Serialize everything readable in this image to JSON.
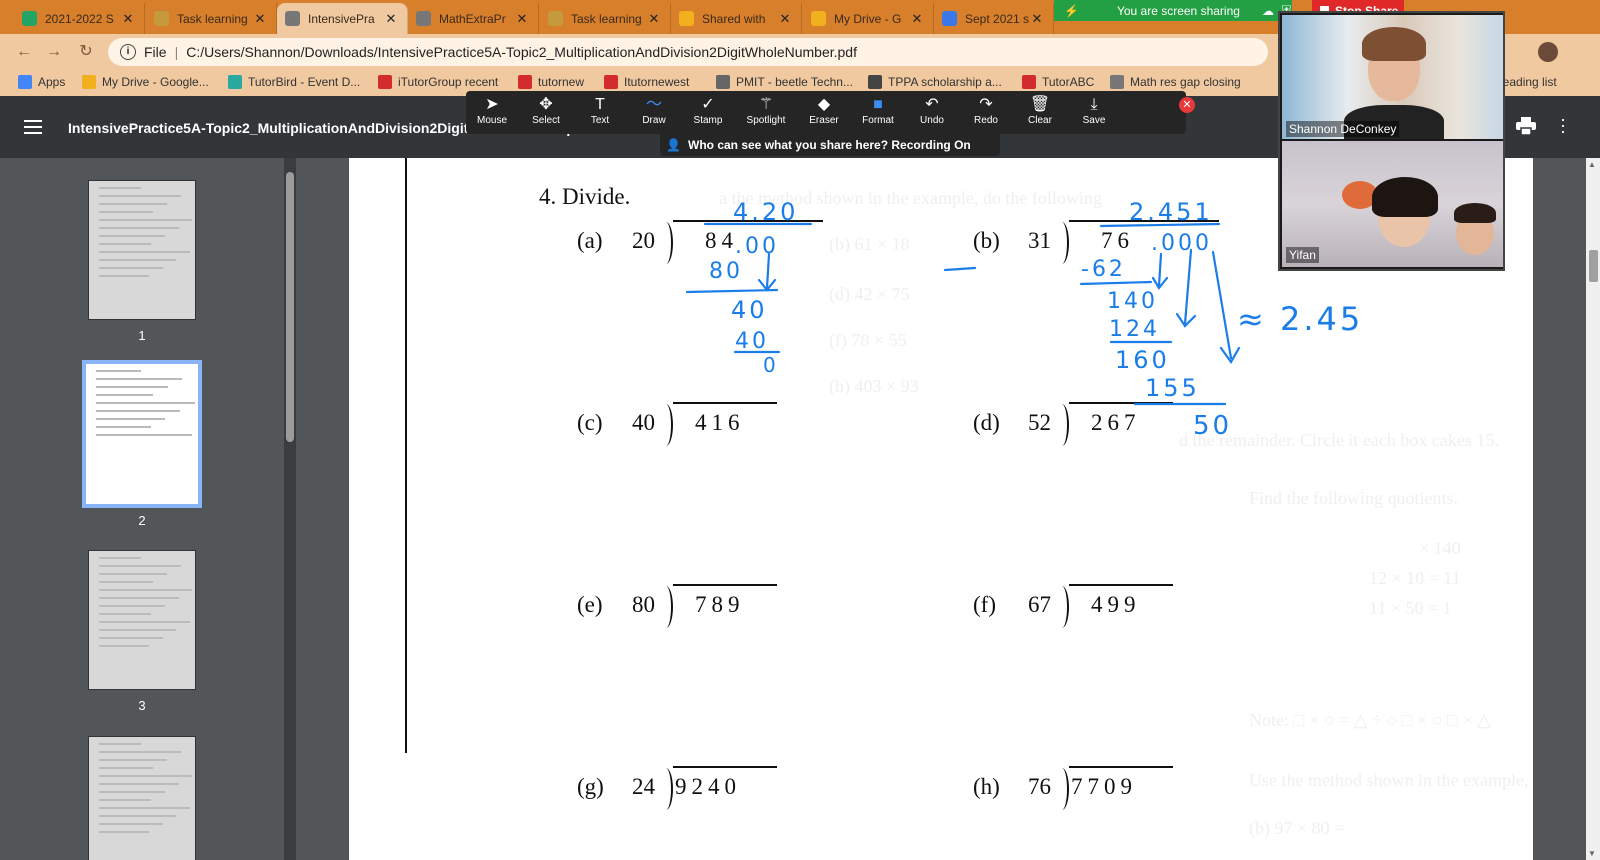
{
  "tabs": [
    {
      "label": "2021-2022 S",
      "favicon": "sheets-icon",
      "color": "#23a566",
      "active": false
    },
    {
      "label": "Task learning",
      "favicon": "task-icon",
      "color": "#c59a3c",
      "active": false
    },
    {
      "label": "IntensivePra",
      "favicon": "web-icon",
      "color": "#777777",
      "active": true
    },
    {
      "label": "MathExtraPr",
      "favicon": "web-icon",
      "color": "#777777",
      "active": false
    },
    {
      "label": "Task learning",
      "favicon": "task-icon",
      "color": "#c59a3c",
      "active": false
    },
    {
      "label": "Shared with",
      "favicon": "drive-icon",
      "color": "#f2b01e",
      "active": false
    },
    {
      "label": "My Drive - G",
      "favicon": "drive-icon",
      "color": "#f2b01e",
      "active": false
    },
    {
      "label": "Sept 2021 sc",
      "favicon": "docs-icon",
      "color": "#3b78e7",
      "active": false
    }
  ],
  "address": {
    "file_label": "File",
    "url": "C:/Users/Shannon/Downloads/IntensivePractice5A-Topic2_MultiplicationAndDivision2DigitWholeNumber.pdf"
  },
  "bookmarks": [
    {
      "label": "Apps",
      "color": "#4285f4"
    },
    {
      "label": "My Drive - Google...",
      "color": "#f2b01e"
    },
    {
      "label": "TutorBird - Event D...",
      "color": "#2aa9a0"
    },
    {
      "label": "iTutorGroup recent",
      "color": "#d22c2c"
    },
    {
      "label": "tutornew",
      "color": "#d22c2c"
    },
    {
      "label": "Itutornewest",
      "color": "#d22c2c"
    },
    {
      "label": "PMIT - beetle Techn...",
      "color": "#666666"
    },
    {
      "label": "TPPA scholarship a...",
      "color": "#444444"
    },
    {
      "label": "TutorABC",
      "color": "#d22c2c"
    },
    {
      "label": "Math res gap closing",
      "color": "#777777"
    },
    {
      "label": "Reading list",
      "color": "#777777"
    }
  ],
  "pdf": {
    "title": "IntensivePractice5A-Topic2_MultiplicationAndDivision2DigitWholeNumber.pdf",
    "thumbnails": [
      {
        "page": "1",
        "selected": false
      },
      {
        "page": "2",
        "selected": true
      },
      {
        "page": "3",
        "selected": false
      },
      {
        "page": "",
        "selected": false
      }
    ]
  },
  "zoom_toolbar": {
    "tools": [
      {
        "label": "Mouse",
        "icon": "cursor-icon",
        "glyph": "➤"
      },
      {
        "label": "Select",
        "icon": "move-icon",
        "glyph": "✥"
      },
      {
        "label": "Text",
        "icon": "text-icon",
        "glyph": "T"
      },
      {
        "label": "Draw",
        "icon": "draw-icon",
        "glyph": "〜"
      },
      {
        "label": "Stamp",
        "icon": "check-icon",
        "glyph": "✓"
      },
      {
        "label": "Spotlight",
        "icon": "wand-icon",
        "glyph": "⚚"
      },
      {
        "label": "Eraser",
        "icon": "eraser-icon",
        "glyph": "◆"
      },
      {
        "label": "Format",
        "icon": "format-icon",
        "glyph": "■"
      },
      {
        "label": "Undo",
        "icon": "undo-icon",
        "glyph": "↶"
      },
      {
        "label": "Redo",
        "icon": "redo-icon",
        "glyph": "↷"
      },
      {
        "label": "Clear",
        "icon": "trash-icon",
        "glyph": "🗑"
      },
      {
        "label": "Save",
        "icon": "save-icon",
        "glyph": "⤓"
      }
    ],
    "active_tool": "Draw",
    "share_note": "Who can see what you share here? Recording On"
  },
  "sharing": {
    "banner": "You are screen sharing",
    "stop_label": "Stop Share"
  },
  "worksheet": {
    "question": "4.  Divide.",
    "problems": [
      {
        "label": "(a)",
        "divisor": "20",
        "dividend": "84"
      },
      {
        "label": "(b)",
        "divisor": "31",
        "dividend": "76"
      },
      {
        "label": "(c)",
        "divisor": "40",
        "dividend": "416"
      },
      {
        "label": "(d)",
        "divisor": "52",
        "dividend": "267"
      },
      {
        "label": "(e)",
        "divisor": "80",
        "dividend": "789"
      },
      {
        "label": "(f)",
        "divisor": "67",
        "dividend": "499"
      },
      {
        "label": "(g)",
        "divisor": "24",
        "dividend": "9240"
      },
      {
        "label": "(h)",
        "divisor": "76",
        "dividend": "7709"
      }
    ],
    "ink": {
      "a_quotient": "4.20",
      "a_dividend_extension": ".00",
      "a_steps": [
        "80",
        "40",
        "40",
        "0"
      ],
      "b_quotient": "2.451",
      "b_dividend_extension": ".000",
      "b_steps": [
        "-62",
        "140",
        "124",
        "160",
        "155",
        "50"
      ],
      "approx": "≈ 2.45"
    }
  },
  "video": {
    "participants": [
      {
        "name": "Shannon DeConkey"
      },
      {
        "name": "Yifan"
      }
    ]
  },
  "ink_color": "#1a7de8"
}
